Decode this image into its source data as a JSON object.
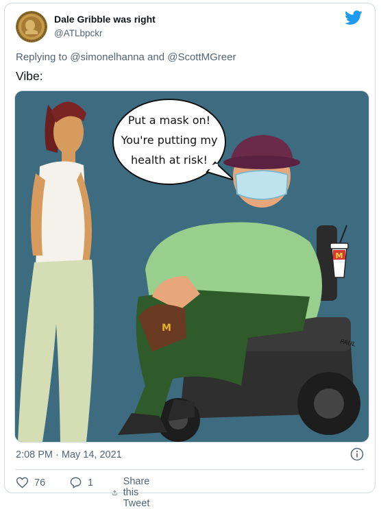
{
  "author": {
    "name": "Dale Gribble was right",
    "handle": "@ATLbpckr",
    "avatar_icon": "gold-coin-avatar"
  },
  "reply": {
    "prefix": "Replying to",
    "mention_1": "@simonelhanna",
    "conjunction": "and",
    "mention_2": "@ScottMGreer"
  },
  "tweet": {
    "text": "Vibe:"
  },
  "media": {
    "speech_line_1": "Put a mask on!",
    "speech_line_2": "You're putting my",
    "speech_line_3": "health at risk!",
    "cup_logo": "M",
    "bag_logo": "M",
    "signature": "PAUL"
  },
  "meta": {
    "timestamp": "2:08 PM · May 14, 2021"
  },
  "actions": {
    "likes": "76",
    "replies": "1",
    "share_label": "Share this Tweet"
  },
  "colors": {
    "brand": "#1d9bf0",
    "text_secondary": "#536471",
    "border": "#cfd9de",
    "background_comic": "#3d6b7f"
  }
}
